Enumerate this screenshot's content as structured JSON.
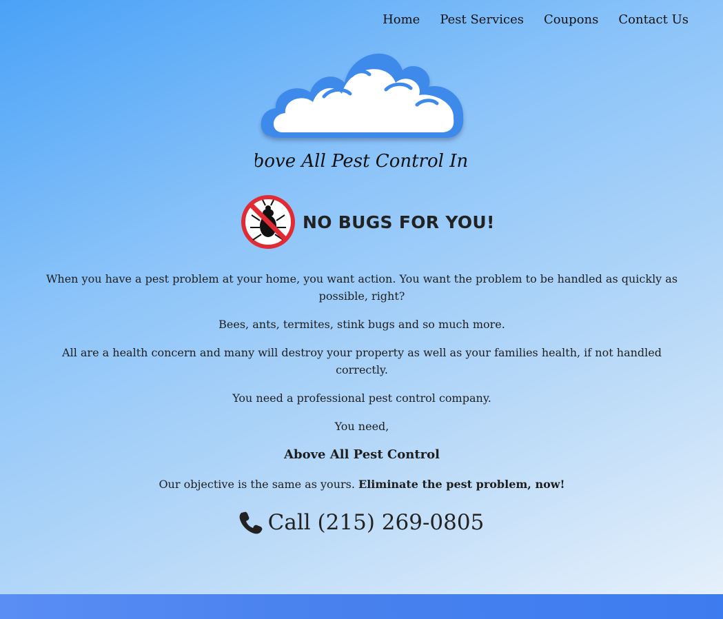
{
  "nav": {
    "items": [
      "Home",
      "Pest Services",
      "Coupons",
      "Contact Us"
    ]
  },
  "logo": {
    "text": "Above All Pest Control Inc.",
    "icon": "cloud-icon"
  },
  "headline": {
    "icon": "no-bug-icon",
    "title": "NO BUGS FOR YOU!"
  },
  "content": {
    "p1": "When you have a pest problem at your home, you want action. You want the problem to be handled as quickly as possible, right?",
    "p2": "Bees, ants, termites, stink bugs and so much more.",
    "p3": "All are a health concern and many will destroy your property as well as your families health, if not handled correctly.",
    "p4": "You need a professional pest control company.",
    "p5": "You need,",
    "brand": "Above All Pest Control",
    "objective_prefix": "Our objective is the same as yours.",
    "objective_bold": "Eliminate the pest problem, now!"
  },
  "phone": {
    "icon": "phone-icon",
    "label": "Call (215) 269-0805"
  },
  "colors": {
    "gradient_start": "#4aa2f7",
    "gradient_end": "#e9f2fb",
    "accent_blue": "#3d7cf0",
    "no_sign_red": "#e02b35"
  }
}
